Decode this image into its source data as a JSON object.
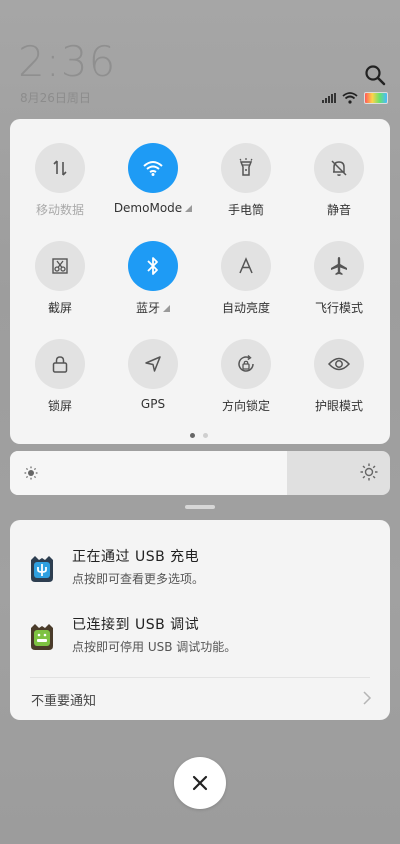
{
  "header": {
    "time": "2:36",
    "date": "8月26日周日"
  },
  "status": {
    "icons": [
      "signal-icon",
      "wifi-icon",
      "battery-icon"
    ]
  },
  "quick_settings": {
    "tiles": [
      {
        "label": "移动数据",
        "icon": "mobile-data-icon",
        "active": false,
        "disabled": true
      },
      {
        "label": "DemoMode",
        "icon": "wifi-icon",
        "active": true,
        "disabled": false,
        "has_more": true
      },
      {
        "label": "手电筒",
        "icon": "flashlight-icon",
        "active": false,
        "disabled": false
      },
      {
        "label": "静音",
        "icon": "silent-bell-icon",
        "active": false,
        "disabled": false
      },
      {
        "label": "截屏",
        "icon": "screenshot-icon",
        "active": false,
        "disabled": false
      },
      {
        "label": "蓝牙",
        "icon": "bluetooth-icon",
        "active": true,
        "disabled": false,
        "has_more": true
      },
      {
        "label": "自动亮度",
        "icon": "auto-brightness-icon",
        "active": false,
        "disabled": false
      },
      {
        "label": "飞行模式",
        "icon": "airplane-icon",
        "active": false,
        "disabled": false
      },
      {
        "label": "锁屏",
        "icon": "lock-icon",
        "active": false,
        "disabled": false
      },
      {
        "label": "GPS",
        "icon": "gps-icon",
        "active": false,
        "disabled": false
      },
      {
        "label": "方向锁定",
        "icon": "rotation-lock-icon",
        "active": false,
        "disabled": false
      },
      {
        "label": "护眼模式",
        "icon": "eye-icon",
        "active": false,
        "disabled": false
      }
    ],
    "page_count": 2,
    "current_page": 1
  },
  "brightness": {
    "level": 0.73
  },
  "notifications": {
    "items": [
      {
        "title": "正在通过 USB 充电",
        "subtitle": "点按即可查看更多选项。",
        "icon": "usb-icon"
      },
      {
        "title": "已连接到 USB 调试",
        "subtitle": "点按即可停用 USB 调试功能。",
        "icon": "android-debug-icon"
      }
    ],
    "dismiss_label": "不重要通知"
  },
  "colors": {
    "accent": "#1e9bf5",
    "panel": "#f4f4f4"
  }
}
